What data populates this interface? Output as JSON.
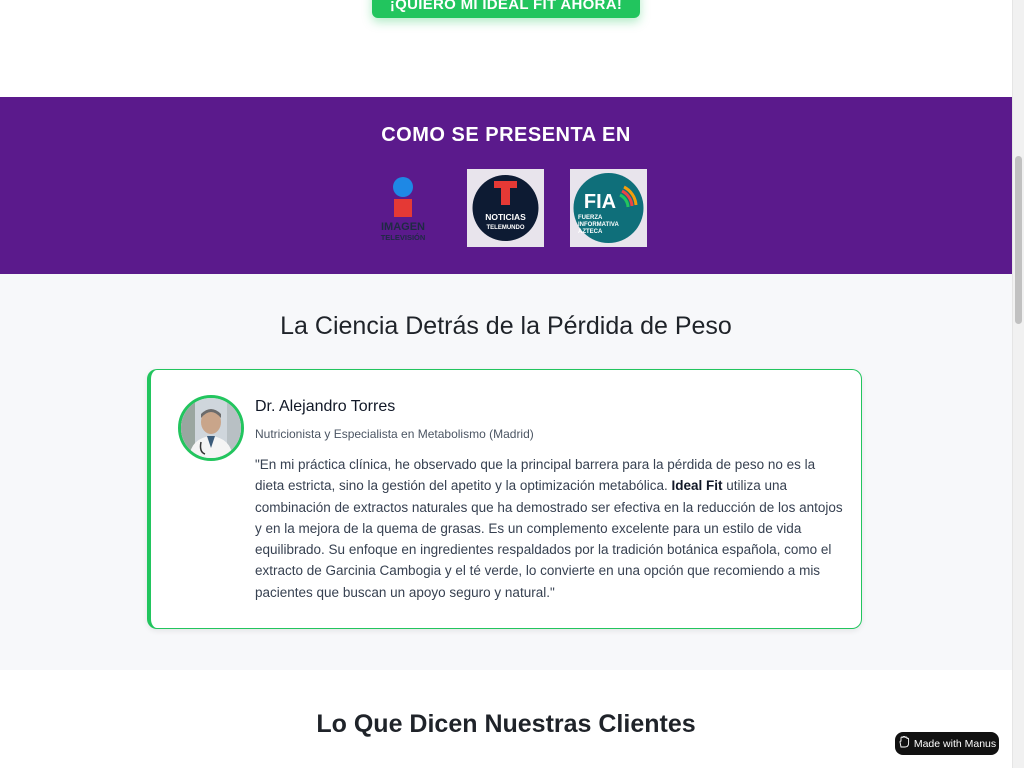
{
  "cta": {
    "label": "¡QUIERO MI IDEAL FIT AHORA!"
  },
  "media": {
    "title": "COMO SE PRESENTA EN",
    "logos": [
      {
        "name": "imagen-television-logo",
        "line1": "IMAGEN",
        "line2": "TELEVISIÓN"
      },
      {
        "name": "noticias-telemundo-logo",
        "line1": "NOTICIAS",
        "line2": "TELEMUNDO"
      },
      {
        "name": "fia-logo",
        "line1": "FIA",
        "line2": "FUERZA",
        "line3": "INFORMATIVA",
        "line4": "AZTECA"
      }
    ]
  },
  "science": {
    "title": "La Ciencia Detrás de la Pérdida de Peso",
    "doctor": {
      "name": "Dr. Alejandro Torres",
      "role": "Nutricionista y Especialista en Metabolismo (Madrid)",
      "quote_part1": "\"En mi práctica clínica, he observado que la principal barrera para la pérdida de peso no es la dieta estricta, sino la gestión del apetito y la optimización metabólica. ",
      "quote_brand": "Ideal Fit",
      "quote_part2": " utiliza una combinación de extractos naturales que ha demostrado ser efectiva en la reducción de los antojos y en la mejora de la quema de grasas. Es un complemento excelente para un estilo de vida equilibrado. Su enfoque en ingredientes respaldados por la tradición botánica española, como el extracto de Garcinia Cambogia y el té verde, lo convierte en una opción que recomiendo a mis pacientes que buscan un apoyo seguro y natural.\""
    }
  },
  "testimonials": {
    "title": "Lo Que Dicen Nuestras Clientes"
  },
  "badge": {
    "label": "Made with Manus"
  },
  "colors": {
    "accent_green": "#22c55e",
    "purple_band": "#5b1a8c",
    "light_bg": "#f7f8fa"
  }
}
